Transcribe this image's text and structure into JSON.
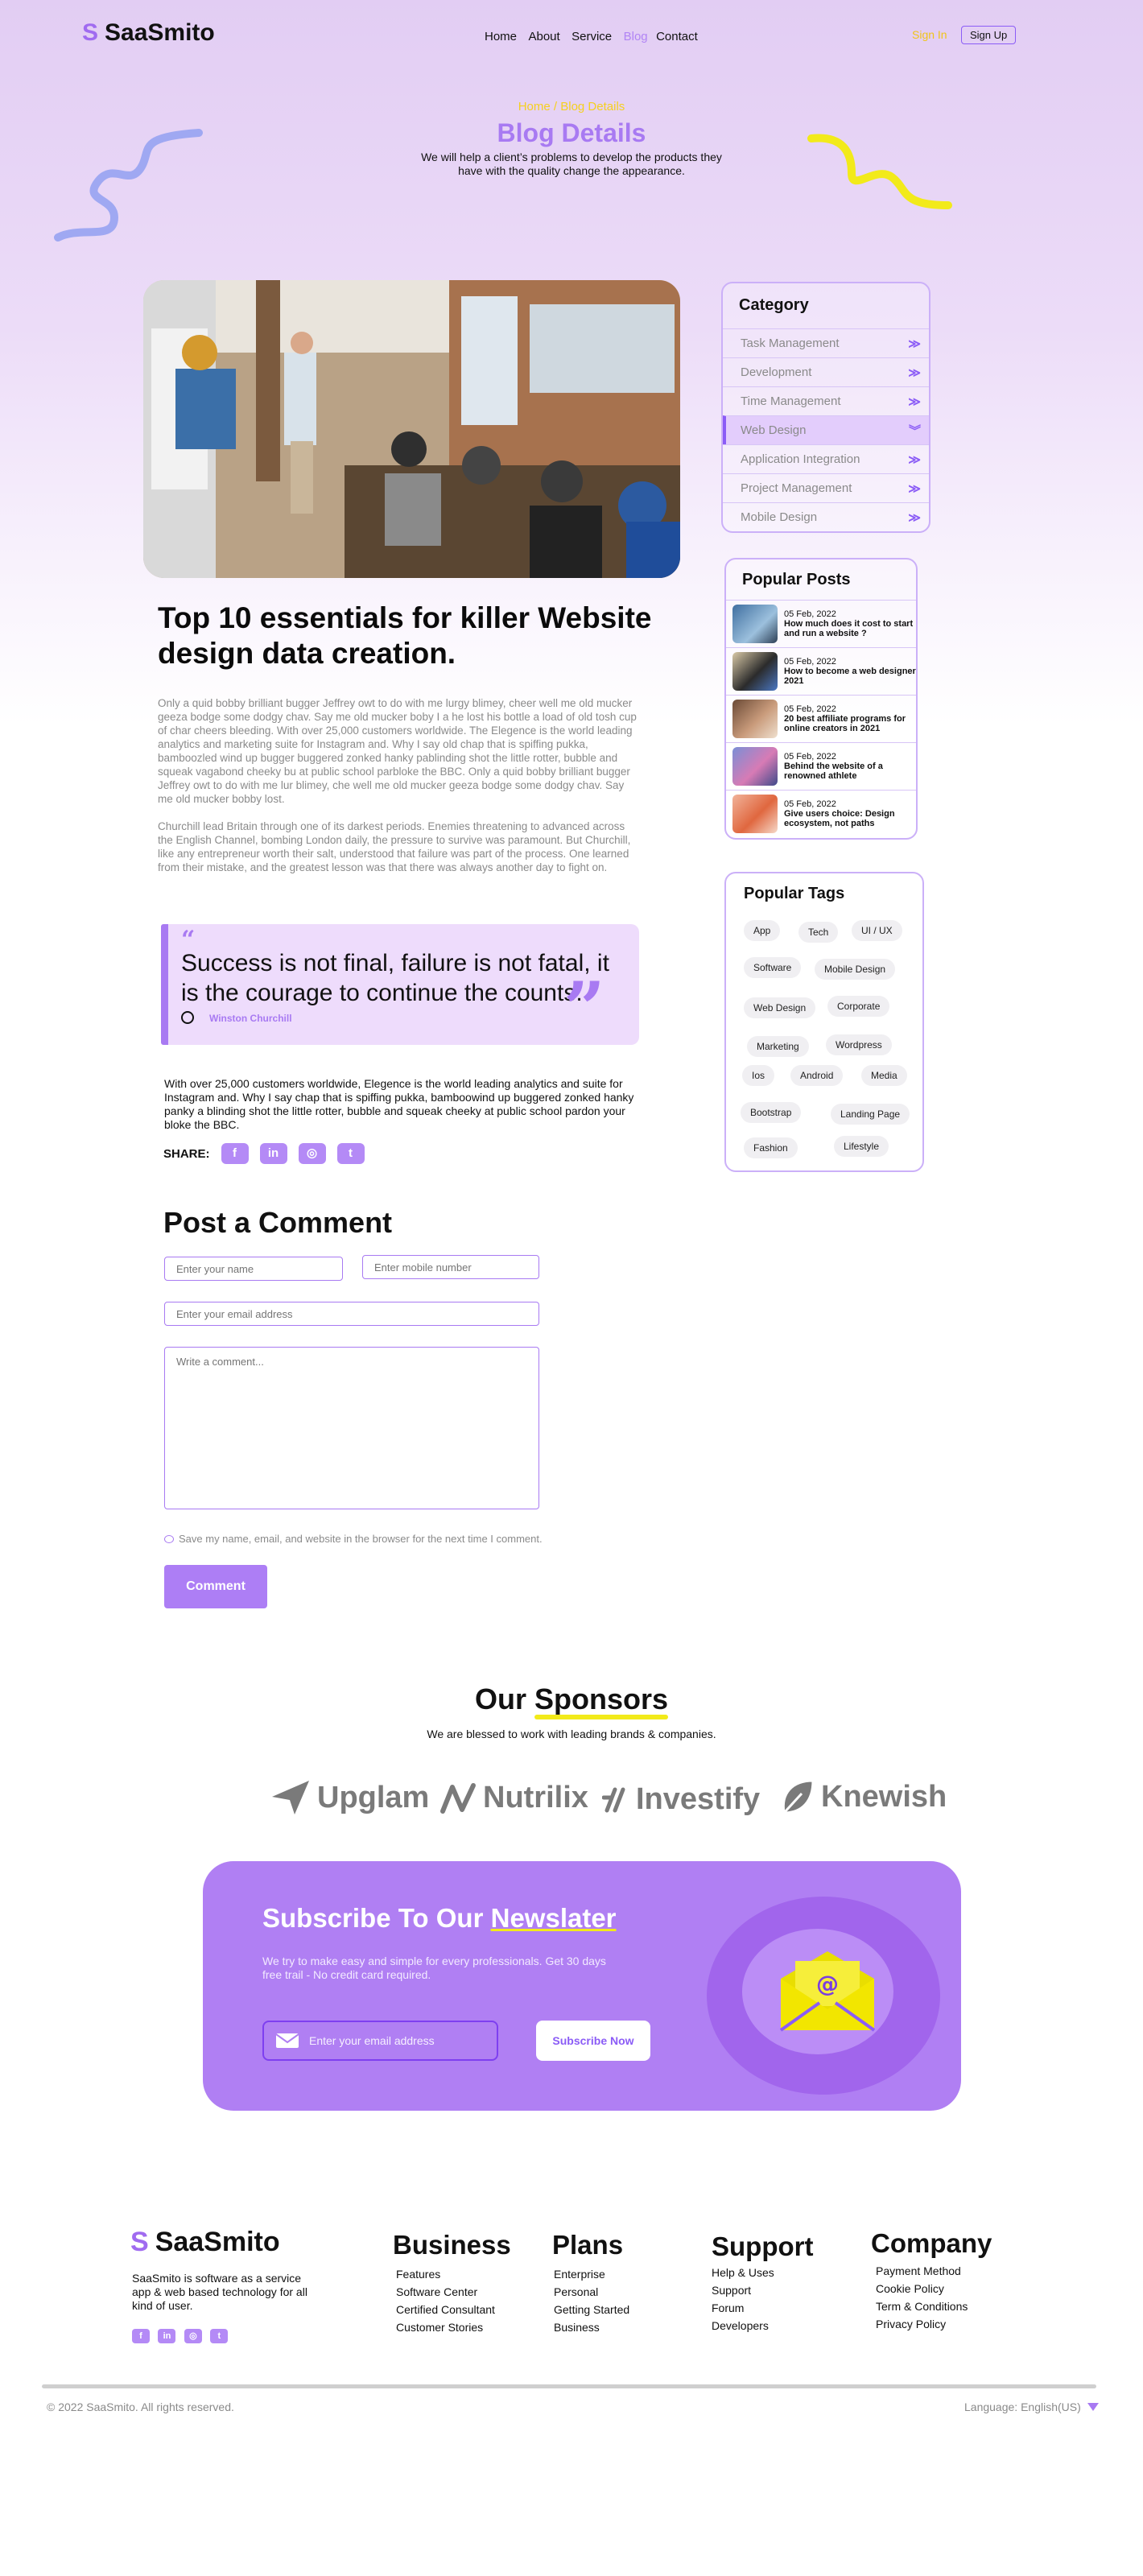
{
  "brand": {
    "mark": "S",
    "name": "SaaSmito"
  },
  "nav": {
    "items": [
      "Home",
      "About",
      "Service",
      "Blog",
      "Contact"
    ],
    "active": "Blog",
    "signin": "Sign In",
    "signup": "Sign Up"
  },
  "hero": {
    "breadcrumb": "Home / Blog Details",
    "title": "Blog Details",
    "subtitle_line1": "We will help a client’s problems to develop the products they",
    "subtitle_line2": "have with the quality change the appearance."
  },
  "article": {
    "title_line1": "Top 10 essentials for killer Website",
    "title_line2": "design data creation.",
    "paragraph1": "Only a quid bobby brilliant bugger Jeffrey owt to do with me lurgy blimey, cheer well me old mucker geeza bodge some dodgy chav. Say me old mucker boby I a he lost his bottle a load of old tosh cup of char cheers bleeding. With over 25,000 customers worldwide. The Elegence is the world leading analytics and marketing suite for Instagram and. Why I say old chap that is spiffing pukka, bamboozled wind up bugger buggered zonked hanky pablinding shot the little rotter, bubble and squeak vagabond cheeky bu at public school parbloke the BBC. Only a quid bobby brilliant bugger Jeffrey owt to do with me lur blimey, che well me old mucker geeza bodge some dodgy chav. Say me old mucker bobby lost.",
    "paragraph2": "Churchill lead Britain through one of its darkest periods. Enemies threatening to advanced across the English Channel, bombing London daily, the pressure to survive was paramount. But Churchill, like any entrepreneur worth their salt, understood that failure was part of the process. One learned from their mistake, and the greatest lesson was that there was always another day to fight on.",
    "quote": "Success is not final, failure is not fatal, it is the courage to continue the counts.",
    "quote_author": "Winston Churchill",
    "paragraph3": "With over 25,000 customers worldwide, Elegence is the world leading analytics and suite for Instagram and. Why I say chap that is spiffing pukka, bamboowind up buggered zonked hanky panky a blinding shot the little rotter, bubble and squeak cheeky at public school pardon your bloke the BBC.",
    "share_label": "SHARE:",
    "share_icons": [
      "facebook-icon",
      "linkedin-icon",
      "instagram-icon",
      "twitter-icon"
    ]
  },
  "comment_form": {
    "title": "Post a Comment",
    "name_placeholder": "Enter your name",
    "mobile_placeholder": "Enter mobile number",
    "email_placeholder": "Enter your email address",
    "comment_placeholder": "Write a comment...",
    "save_label": "Save my name, email, and website in the browser for the next time I comment.",
    "submit_label": "Comment"
  },
  "category": {
    "title": "Category",
    "items": [
      "Task Management",
      "Development",
      "Time Management",
      "Web Design",
      "Application Integration",
      "Project Management",
      "Mobile Design"
    ],
    "active": "Web Design"
  },
  "popular_posts": {
    "title": "Popular Posts",
    "items": [
      {
        "date": "05 Feb, 2022",
        "title": "How much does it cost to start and run a website ?"
      },
      {
        "date": "05 Feb, 2022",
        "title": "How to become a web designer 2021"
      },
      {
        "date": "05 Feb, 2022",
        "title": "20 best affiliate programs for online creators in 2021"
      },
      {
        "date": "05 Feb, 2022",
        "title": "Behind the website of a renowned athlete"
      },
      {
        "date": "05 Feb, 2022",
        "title": "Give users choice: Design ecosystem, not paths"
      }
    ]
  },
  "popular_tags": {
    "title": "Popular Tags",
    "tags": [
      "App",
      "Tech",
      "UI / UX",
      "Software",
      "Mobile Design",
      "Web Design",
      "Corporate",
      "Marketing",
      "Wordpress",
      "Ios",
      "Android",
      "Media",
      "Bootstrap",
      "Landing Page",
      "Fashion",
      "Lifestyle"
    ]
  },
  "sponsors": {
    "title_prefix": "Our",
    "title_highlight": "Sponsors",
    "subtitle": "We are blessed to work with leading brands & companies.",
    "brands": [
      "Upglam",
      "Nutrilix",
      "Investify",
      "Knewish"
    ]
  },
  "newsletter": {
    "title_prefix": "Subscribe To Our",
    "title_highlight": "Newslater",
    "subtitle_line1": "We try to make easy and simple for every professionals. Get 30 days",
    "subtitle_line2": "free trail - No credit card required.",
    "email_placeholder": "Enter your email address",
    "button": "Subscribe Now"
  },
  "footer": {
    "description": "SaaSmito is software as a service app & web based technology for all kind of user.",
    "columns": [
      {
        "title": "Business",
        "links": [
          "Features",
          "Software Center",
          "Certified Consultant",
          "Customer Stories"
        ]
      },
      {
        "title": "Plans",
        "links": [
          "Enterprise",
          "Personal",
          "Getting Started",
          "Business"
        ]
      },
      {
        "title": "Support",
        "links": [
          "Help & Uses",
          "Support",
          "Forum",
          "Developers"
        ]
      },
      {
        "title": "Company",
        "links": [
          "Payment Method",
          "Cookie Policy",
          "Term & Conditions",
          "Privacy Policy"
        ]
      }
    ],
    "copyright": "© 2022 SaaSmito. All rights reserved.",
    "language": "Language: English(US)"
  },
  "colors": {
    "accent": "#a87af2",
    "accent_dark": "#8b5cf6",
    "highlight": "#f2ea1a",
    "hero_bg": "#e2cdf3",
    "newsletter_bg": "#b07ff3"
  }
}
